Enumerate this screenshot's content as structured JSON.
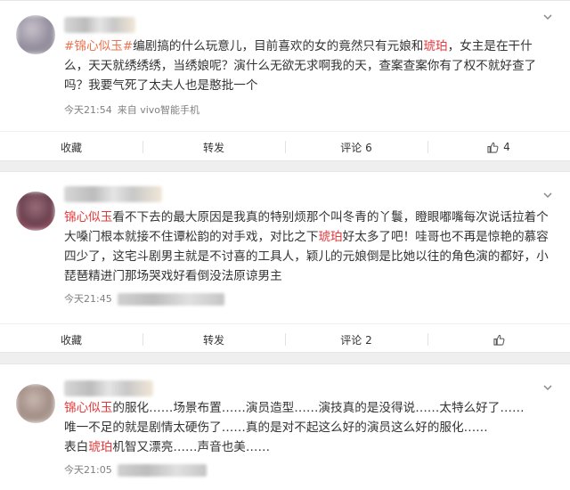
{
  "posts": [
    {
      "content_parts": [
        {
          "t": "#锦心似玉#",
          "style": "hl"
        },
        {
          "t": "编剧搞的什么玩意儿，目前喜欢的女的竟然只有元娘和",
          "style": ""
        },
        {
          "t": "琥珀",
          "style": "hl-red"
        },
        {
          "t": "，女主是在干什么，天天就绣绣绣，当绣娘呢？演什么无欲无求啊我的天，查案查案你有了权不就好查了吗？我要气死了太夫人也是憨批一个",
          "style": ""
        }
      ],
      "time": "今天21:54",
      "source": "来自 vivo智能手机",
      "actions": {
        "favorite": "收藏",
        "repost": "转发",
        "comment": "评论 6",
        "like_count": "4"
      }
    },
    {
      "content_parts": [
        {
          "t": "锦心似玉",
          "style": "hl-red"
        },
        {
          "t": "看不下去的最大原因是我真的特别烦那个叫冬青的丫鬟，瞪眼嘟嘴每次说话拉着个大嗓门根本就接不住谭松韵的对手戏，对比之下",
          "style": ""
        },
        {
          "t": "琥珀",
          "style": "hl-red"
        },
        {
          "t": "好太多了吧！哇哥也不再是惊艳的慕容四少了，这宅斗剧男主就是不讨喜的工具人，颖儿的元娘倒是比她以往的角色演的都好，小琵琶精进门那场哭戏好看倒没法原谅男主",
          "style": ""
        }
      ],
      "time": "今天21:45",
      "source": "",
      "actions": {
        "favorite": "收藏",
        "repost": "转发",
        "comment": "评论 2",
        "like_count": ""
      }
    },
    {
      "content_parts": [
        {
          "t": "锦心似玉",
          "style": "hl-red"
        },
        {
          "t": "的服化……场景布置……演员造型……演技真的是没得说……太特么好了……",
          "style": ""
        },
        {
          "t": "\n唯一不足的就是剧情太硬伤了……真的是对不起这么好的演员这么好的服化……",
          "style": ""
        },
        {
          "t": "\n表白",
          "style": ""
        },
        {
          "t": "琥珀",
          "style": "hl-red"
        },
        {
          "t": "机智又漂亮……声音也美……",
          "style": ""
        }
      ],
      "time": "今天21:05",
      "source": "",
      "actions": {}
    }
  ],
  "colors": {
    "accent": "#eb7350",
    "keyword": "#e4393c",
    "meta": "#808080"
  },
  "icons": {
    "chevron": "chevron-down-icon",
    "like": "thumbs-up-icon"
  }
}
